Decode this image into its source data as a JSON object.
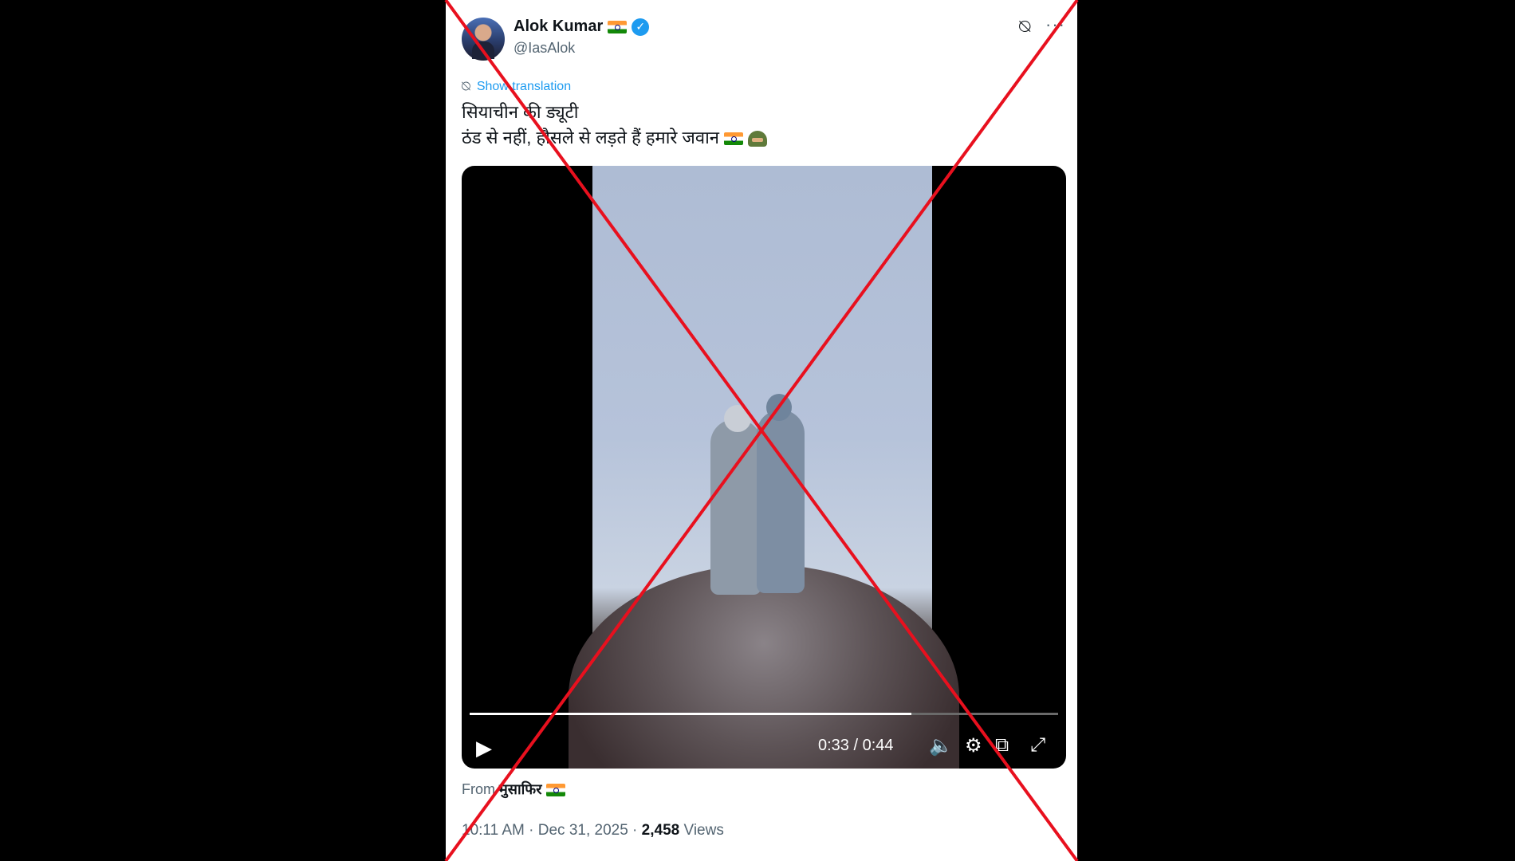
{
  "author": {
    "name": "Alok Kumar",
    "handle": "@IasAlok"
  },
  "tweet": {
    "translate_label": "Show translation",
    "line1": "सियाचीन की ड्यूटी",
    "line2": "ठंड से नहीं, हौसले से लड़ते हैं हमारे जवान"
  },
  "video": {
    "time": "0:33 / 0:44",
    "progress": 0.75
  },
  "source": {
    "prefix": "From",
    "name": "मुसाफिर"
  },
  "meta": {
    "time": "10:11 AM · Dec 31, 2025 · ",
    "views_count": "2,458",
    "views_label": " Views"
  },
  "icons": {
    "verified": "verified-badge-icon",
    "grok": "grok-icon",
    "more": "more-icon",
    "play": "play-icon",
    "volume": "volume-icon",
    "settings": "settings-icon",
    "dock": "dock-icon",
    "fullscreen": "fullscreen-icon"
  },
  "colors": {
    "accent": "#1d9bf0",
    "cross": "#e8101e"
  }
}
